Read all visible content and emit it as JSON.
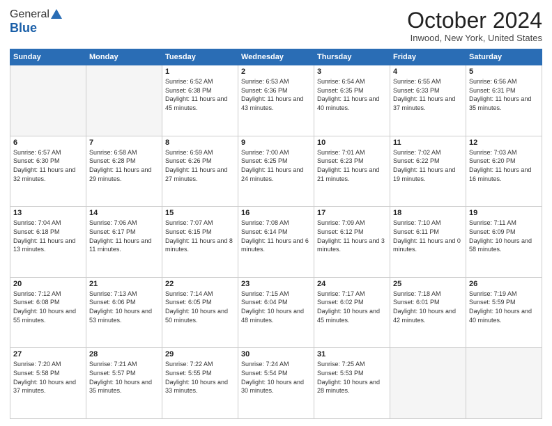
{
  "header": {
    "logo_general": "General",
    "logo_blue": "Blue",
    "month_title": "October 2024",
    "location": "Inwood, New York, United States"
  },
  "weekdays": [
    "Sunday",
    "Monday",
    "Tuesday",
    "Wednesday",
    "Thursday",
    "Friday",
    "Saturday"
  ],
  "weeks": [
    [
      {
        "day": "",
        "sunrise": "",
        "sunset": "",
        "daylight": ""
      },
      {
        "day": "",
        "sunrise": "",
        "sunset": "",
        "daylight": ""
      },
      {
        "day": "1",
        "sunrise": "Sunrise: 6:52 AM",
        "sunset": "Sunset: 6:38 PM",
        "daylight": "Daylight: 11 hours and 45 minutes."
      },
      {
        "day": "2",
        "sunrise": "Sunrise: 6:53 AM",
        "sunset": "Sunset: 6:36 PM",
        "daylight": "Daylight: 11 hours and 43 minutes."
      },
      {
        "day": "3",
        "sunrise": "Sunrise: 6:54 AM",
        "sunset": "Sunset: 6:35 PM",
        "daylight": "Daylight: 11 hours and 40 minutes."
      },
      {
        "day": "4",
        "sunrise": "Sunrise: 6:55 AM",
        "sunset": "Sunset: 6:33 PM",
        "daylight": "Daylight: 11 hours and 37 minutes."
      },
      {
        "day": "5",
        "sunrise": "Sunrise: 6:56 AM",
        "sunset": "Sunset: 6:31 PM",
        "daylight": "Daylight: 11 hours and 35 minutes."
      }
    ],
    [
      {
        "day": "6",
        "sunrise": "Sunrise: 6:57 AM",
        "sunset": "Sunset: 6:30 PM",
        "daylight": "Daylight: 11 hours and 32 minutes."
      },
      {
        "day": "7",
        "sunrise": "Sunrise: 6:58 AM",
        "sunset": "Sunset: 6:28 PM",
        "daylight": "Daylight: 11 hours and 29 minutes."
      },
      {
        "day": "8",
        "sunrise": "Sunrise: 6:59 AM",
        "sunset": "Sunset: 6:26 PM",
        "daylight": "Daylight: 11 hours and 27 minutes."
      },
      {
        "day": "9",
        "sunrise": "Sunrise: 7:00 AM",
        "sunset": "Sunset: 6:25 PM",
        "daylight": "Daylight: 11 hours and 24 minutes."
      },
      {
        "day": "10",
        "sunrise": "Sunrise: 7:01 AM",
        "sunset": "Sunset: 6:23 PM",
        "daylight": "Daylight: 11 hours and 21 minutes."
      },
      {
        "day": "11",
        "sunrise": "Sunrise: 7:02 AM",
        "sunset": "Sunset: 6:22 PM",
        "daylight": "Daylight: 11 hours and 19 minutes."
      },
      {
        "day": "12",
        "sunrise": "Sunrise: 7:03 AM",
        "sunset": "Sunset: 6:20 PM",
        "daylight": "Daylight: 11 hours and 16 minutes."
      }
    ],
    [
      {
        "day": "13",
        "sunrise": "Sunrise: 7:04 AM",
        "sunset": "Sunset: 6:18 PM",
        "daylight": "Daylight: 11 hours and 13 minutes."
      },
      {
        "day": "14",
        "sunrise": "Sunrise: 7:06 AM",
        "sunset": "Sunset: 6:17 PM",
        "daylight": "Daylight: 11 hours and 11 minutes."
      },
      {
        "day": "15",
        "sunrise": "Sunrise: 7:07 AM",
        "sunset": "Sunset: 6:15 PM",
        "daylight": "Daylight: 11 hours and 8 minutes."
      },
      {
        "day": "16",
        "sunrise": "Sunrise: 7:08 AM",
        "sunset": "Sunset: 6:14 PM",
        "daylight": "Daylight: 11 hours and 6 minutes."
      },
      {
        "day": "17",
        "sunrise": "Sunrise: 7:09 AM",
        "sunset": "Sunset: 6:12 PM",
        "daylight": "Daylight: 11 hours and 3 minutes."
      },
      {
        "day": "18",
        "sunrise": "Sunrise: 7:10 AM",
        "sunset": "Sunset: 6:11 PM",
        "daylight": "Daylight: 11 hours and 0 minutes."
      },
      {
        "day": "19",
        "sunrise": "Sunrise: 7:11 AM",
        "sunset": "Sunset: 6:09 PM",
        "daylight": "Daylight: 10 hours and 58 minutes."
      }
    ],
    [
      {
        "day": "20",
        "sunrise": "Sunrise: 7:12 AM",
        "sunset": "Sunset: 6:08 PM",
        "daylight": "Daylight: 10 hours and 55 minutes."
      },
      {
        "day": "21",
        "sunrise": "Sunrise: 7:13 AM",
        "sunset": "Sunset: 6:06 PM",
        "daylight": "Daylight: 10 hours and 53 minutes."
      },
      {
        "day": "22",
        "sunrise": "Sunrise: 7:14 AM",
        "sunset": "Sunset: 6:05 PM",
        "daylight": "Daylight: 10 hours and 50 minutes."
      },
      {
        "day": "23",
        "sunrise": "Sunrise: 7:15 AM",
        "sunset": "Sunset: 6:04 PM",
        "daylight": "Daylight: 10 hours and 48 minutes."
      },
      {
        "day": "24",
        "sunrise": "Sunrise: 7:17 AM",
        "sunset": "Sunset: 6:02 PM",
        "daylight": "Daylight: 10 hours and 45 minutes."
      },
      {
        "day": "25",
        "sunrise": "Sunrise: 7:18 AM",
        "sunset": "Sunset: 6:01 PM",
        "daylight": "Daylight: 10 hours and 42 minutes."
      },
      {
        "day": "26",
        "sunrise": "Sunrise: 7:19 AM",
        "sunset": "Sunset: 5:59 PM",
        "daylight": "Daylight: 10 hours and 40 minutes."
      }
    ],
    [
      {
        "day": "27",
        "sunrise": "Sunrise: 7:20 AM",
        "sunset": "Sunset: 5:58 PM",
        "daylight": "Daylight: 10 hours and 37 minutes."
      },
      {
        "day": "28",
        "sunrise": "Sunrise: 7:21 AM",
        "sunset": "Sunset: 5:57 PM",
        "daylight": "Daylight: 10 hours and 35 minutes."
      },
      {
        "day": "29",
        "sunrise": "Sunrise: 7:22 AM",
        "sunset": "Sunset: 5:55 PM",
        "daylight": "Daylight: 10 hours and 33 minutes."
      },
      {
        "day": "30",
        "sunrise": "Sunrise: 7:24 AM",
        "sunset": "Sunset: 5:54 PM",
        "daylight": "Daylight: 10 hours and 30 minutes."
      },
      {
        "day": "31",
        "sunrise": "Sunrise: 7:25 AM",
        "sunset": "Sunset: 5:53 PM",
        "daylight": "Daylight: 10 hours and 28 minutes."
      },
      {
        "day": "",
        "sunrise": "",
        "sunset": "",
        "daylight": ""
      },
      {
        "day": "",
        "sunrise": "",
        "sunset": "",
        "daylight": ""
      }
    ]
  ]
}
